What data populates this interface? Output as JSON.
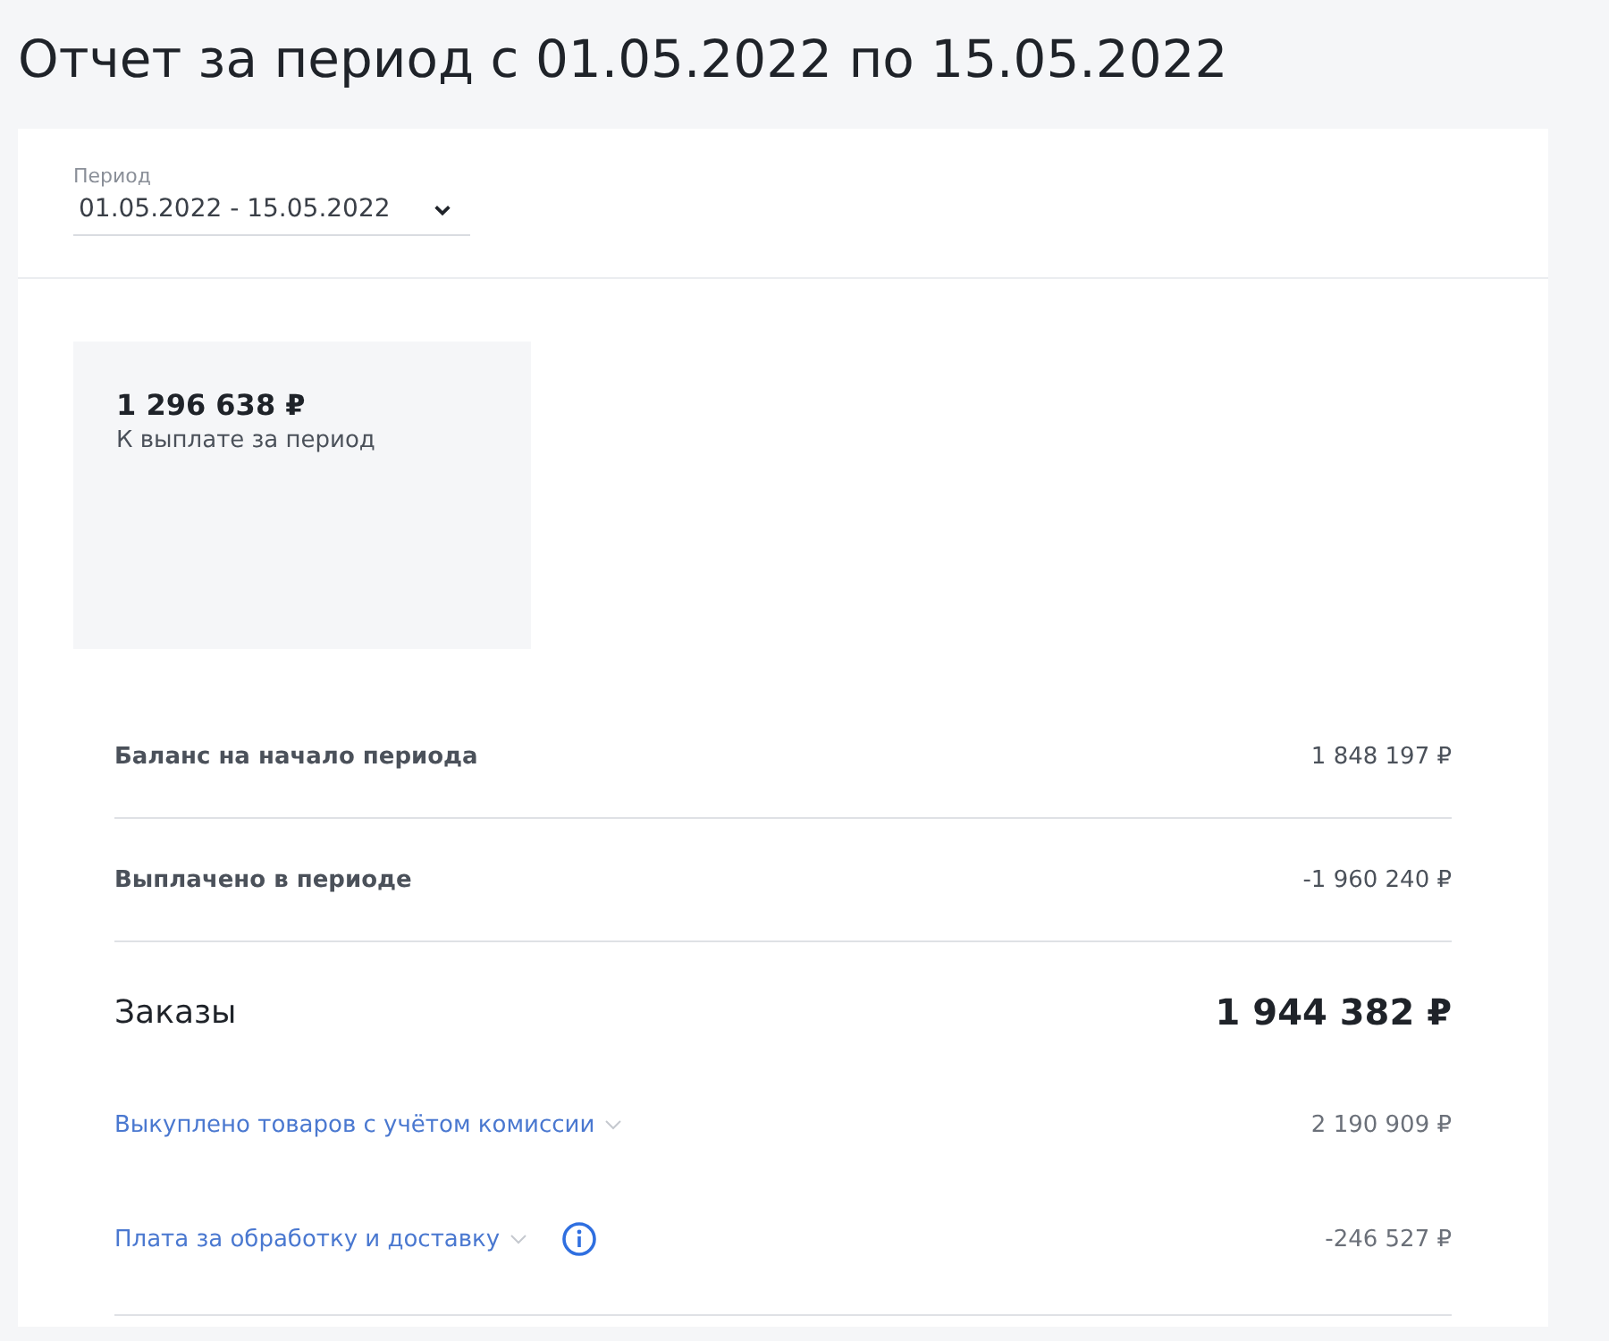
{
  "title": "Отчет за период с 01.05.2022 по 15.05.2022",
  "period": {
    "label": "Период",
    "value": "01.05.2022 - 15.05.2022"
  },
  "summary": {
    "amount": "1 296 638 ₽",
    "caption": "К выплате за период"
  },
  "rows": [
    {
      "kind": "balance",
      "label": "Баланс на начало периода",
      "amount": "1 848 197 ₽"
    },
    {
      "kind": "balance",
      "label": "Выплачено в периоде",
      "amount": "-1 960 240 ₽"
    },
    {
      "kind": "section",
      "label": "Заказы",
      "amount": "1 944 382 ₽"
    },
    {
      "kind": "detail",
      "label": "Выкуплено товаров с учётом комиссии",
      "amount": "2 190 909 ₽",
      "info": false
    },
    {
      "kind": "detail",
      "label": "Плата за обработку и доставку",
      "amount": "-246 527 ₽",
      "info": true
    }
  ]
}
